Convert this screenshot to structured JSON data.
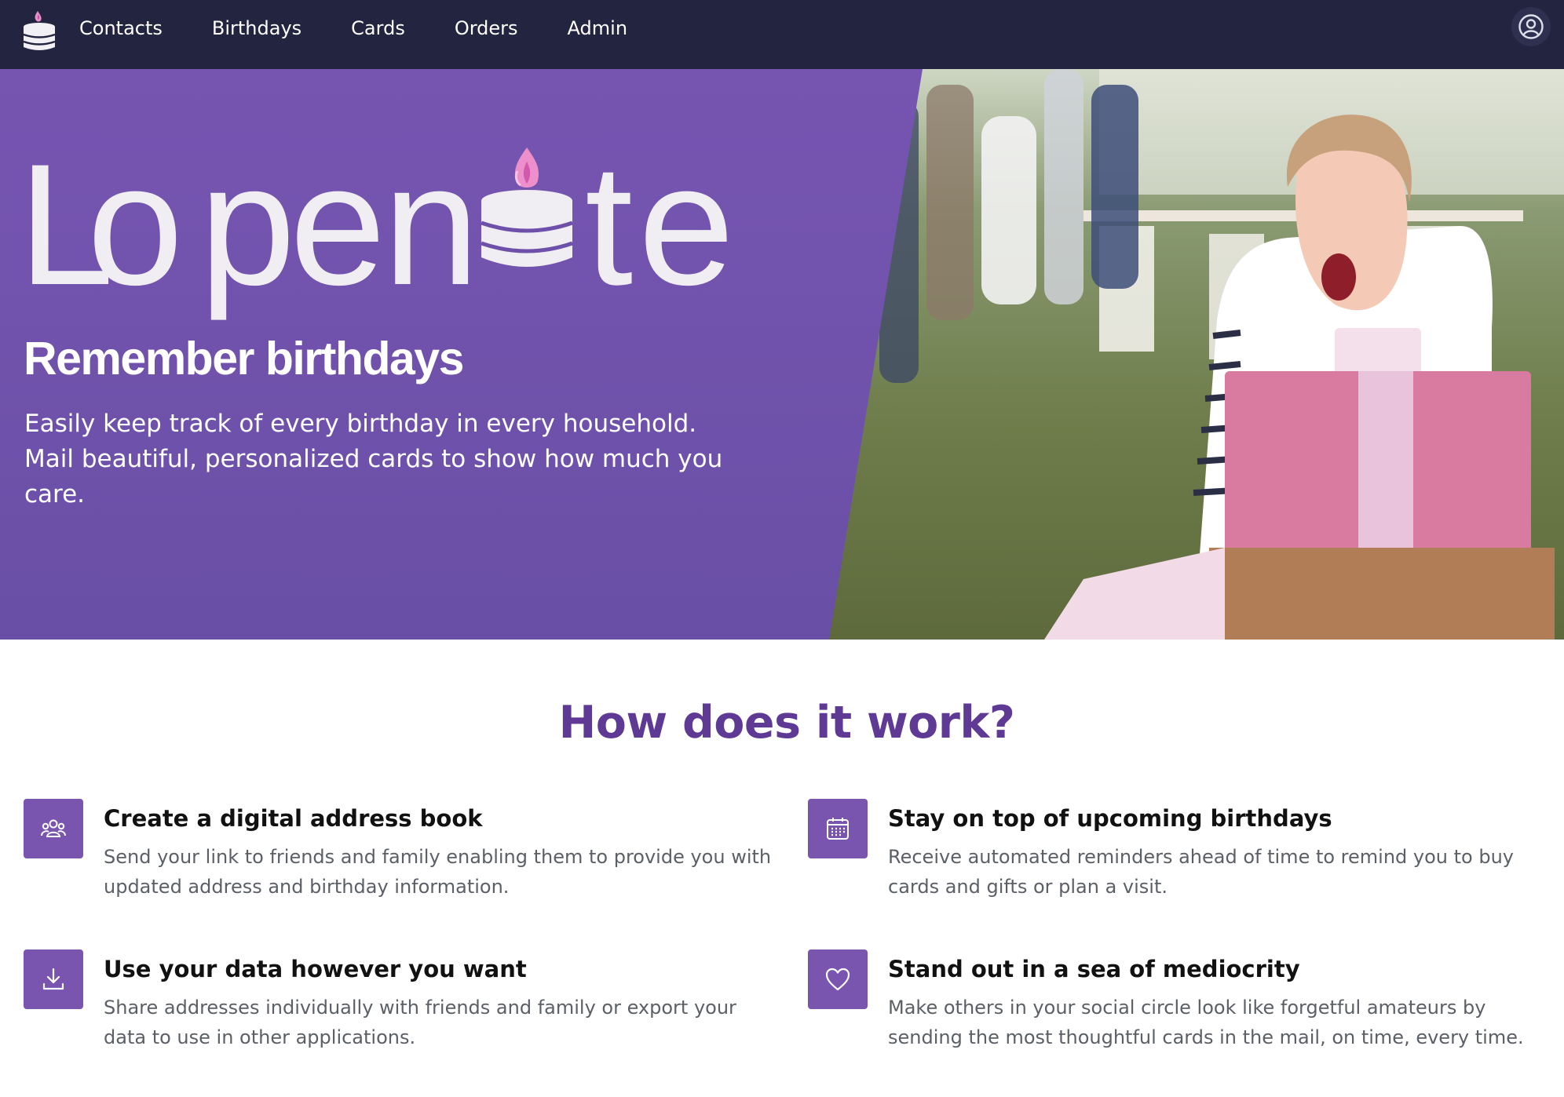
{
  "nav": {
    "logo_icon": "birthday-cake-icon",
    "items": [
      {
        "label": "Contacts"
      },
      {
        "label": "Birthdays"
      },
      {
        "label": "Cards"
      },
      {
        "label": "Orders"
      },
      {
        "label": "Admin"
      }
    ],
    "account_icon": "user-circle-icon"
  },
  "hero": {
    "brand_letters": [
      "L",
      "o",
      "p",
      "e",
      "n",
      "t",
      "e"
    ],
    "title": "Remember birthdays",
    "subtitle": "Easily keep track of every birthday in every household. Mail beautiful, personalized cards to show how much you care.",
    "panel_color": "#7152aa",
    "photo_icon": "birthday-party-photo"
  },
  "how": {
    "title": "How does it work?",
    "accent_color": "#7a55b0",
    "features": [
      {
        "icon": "people-group-icon",
        "title": "Create a digital address book",
        "text": "Send your link to friends and family enabling them to provide you with updated address and birthday information."
      },
      {
        "icon": "calendar-icon",
        "title": "Stay on top of upcoming birthdays",
        "text": "Receive automated reminders ahead of time to remind you to buy cards and gifts or plan a visit."
      },
      {
        "icon": "download-icon",
        "title": "Use your data however you want",
        "text": "Share addresses individually with friends and family or export your data to use in other applications."
      },
      {
        "icon": "heart-icon",
        "title": "Stand out in a sea of mediocrity",
        "text": "Make others in your social circle look like forgetful amateurs by sending the most thoughtful cards in the mail, on time, every time."
      }
    ]
  }
}
